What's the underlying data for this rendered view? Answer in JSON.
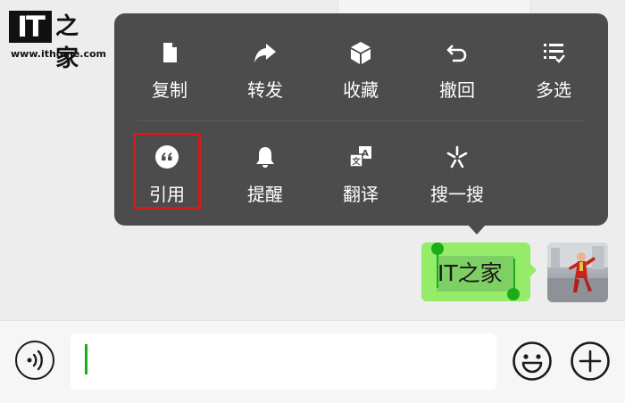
{
  "watermark": {
    "logo_mark": "IT",
    "logo_glyph": "之家",
    "url": "www.ithome.com"
  },
  "context_menu": {
    "row1": [
      {
        "label": "复制",
        "icon": "document-icon"
      },
      {
        "label": "转发",
        "icon": "share-forward-icon"
      },
      {
        "label": "收藏",
        "icon": "cube-icon"
      },
      {
        "label": "撤回",
        "icon": "undo-icon"
      },
      {
        "label": "多选",
        "icon": "multi-select-icon"
      }
    ],
    "row2": [
      {
        "label": "引用",
        "icon": "quote-icon",
        "highlighted": true
      },
      {
        "label": "提醒",
        "icon": "bell-icon"
      },
      {
        "label": "翻译",
        "icon": "translate-icon"
      },
      {
        "label": "搜一搜",
        "icon": "search-sparkle-icon"
      }
    ]
  },
  "message": {
    "text": "IT之家",
    "selected": true,
    "bubble_color": "#95ec69"
  },
  "input_bar": {
    "value": "",
    "voice_icon": "voice-icon",
    "emoji_icon": "emoji-icon",
    "more_icon": "plus-icon"
  },
  "colors": {
    "menu_bg": "#4c4c4c",
    "highlight_border": "#d11c1c",
    "accent_green": "#1aad19"
  }
}
